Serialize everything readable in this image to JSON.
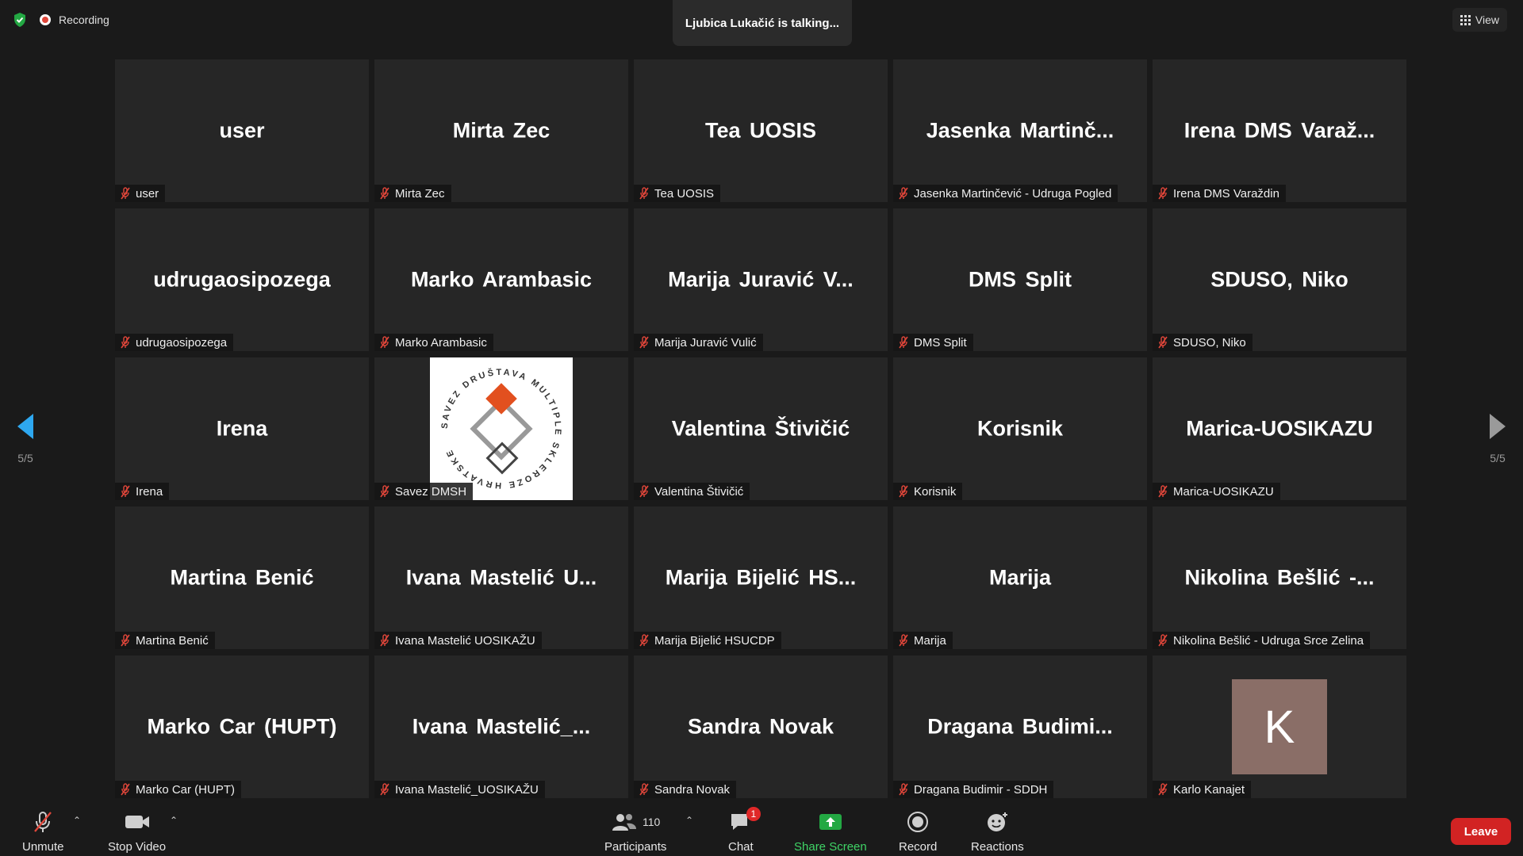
{
  "topbar": {
    "recording_label": "Recording",
    "talking_text": "Ljubica Lukačić is talking...",
    "view_label": "View"
  },
  "pagination": {
    "left": "5/5",
    "right": "5/5"
  },
  "tiles": [
    {
      "big": "user",
      "name": "user"
    },
    {
      "big": "Mirta Zec",
      "name": "Mirta Zec"
    },
    {
      "big": "Tea UOSIS",
      "name": "Tea UOSIS"
    },
    {
      "big": "Jasenka Martinč...",
      "name": "Jasenka Martinčević - Udruga Pogled"
    },
    {
      "big": "Irena DMS Varaž...",
      "name": "Irena DMS Varaždin"
    },
    {
      "big": "udrugaosipozega",
      "name": "udrugaosipozega"
    },
    {
      "big": "Marko Arambasic",
      "name": "Marko Arambasic"
    },
    {
      "big": "Marija Juravić V...",
      "name": "Marija Juravić Vulić"
    },
    {
      "big": "DMS Split",
      "name": "DMS Split"
    },
    {
      "big": "SDUSO, Niko",
      "name": "SDUSO, Niko"
    },
    {
      "big": "Irena",
      "name": "Irena"
    },
    {
      "big": "",
      "name": "Savez DMSH",
      "logo_text": "SAVEZ DRUŠTAVA MULTIPLE SKLEROZE HRVATSKE"
    },
    {
      "big": "Valentina Štivičić",
      "name": "Valentina Štivičić"
    },
    {
      "big": "Korisnik",
      "name": "Korisnik"
    },
    {
      "big": "Marica-UOSIKAZU",
      "name": "Marica-UOSIKAZU"
    },
    {
      "big": "Martina Benić",
      "name": "Martina Benić"
    },
    {
      "big": "Ivana Mastelić U...",
      "name": "Ivana Mastelić UOSIKAŽU"
    },
    {
      "big": "Marija Bijelić HS...",
      "name": "Marija Bijelić HSUCDP"
    },
    {
      "big": "Marija",
      "name": "Marija"
    },
    {
      "big": "Nikolina Bešlić -...",
      "name": "Nikolina Bešlić - Udruga Srce Zelina"
    },
    {
      "big": "Marko Car (HUPT)",
      "name": "Marko Car (HUPT)"
    },
    {
      "big": "Ivana Mastelić_...",
      "name": "Ivana Mastelić_UOSIKAŽU"
    },
    {
      "big": "Sandra Novak",
      "name": "Sandra Novak"
    },
    {
      "big": "Dragana Budimi...",
      "name": "Dragana Budimir - SDDH"
    },
    {
      "big": "",
      "name": "Karlo Kanajet",
      "avatar_letter": "K"
    }
  ],
  "toolbar": {
    "unmute": "Unmute",
    "stop_video": "Stop Video",
    "participants_count": "110",
    "participants": "Participants",
    "chat": "Chat",
    "chat_badge": "1",
    "share_screen": "Share Screen",
    "record": "Record",
    "reactions": "Reactions",
    "leave": "Leave"
  },
  "colors": {
    "background": "#1a1a1a",
    "tile": "#262626",
    "muted_red": "#e0463a",
    "share_green": "#3fd466",
    "leave_red": "#d22323",
    "arrow_blue": "#2ea8f0"
  }
}
